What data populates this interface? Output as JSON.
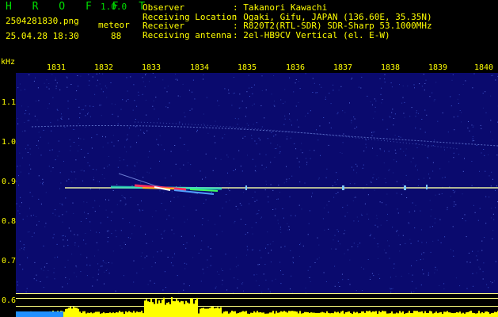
{
  "app": {
    "name": "H R O F F T",
    "version": "1.0.0"
  },
  "file": {
    "name": "2504281830.png",
    "datetime": "25.04.28 18:30"
  },
  "meteor": {
    "label": "meteor",
    "count": "88"
  },
  "info": [
    {
      "key": "Observer",
      "value": ": Takanori Kawachi"
    },
    {
      "key": "Receiving Location",
      "value": ": Ogaki, Gifu, JAPAN (136.60E, 35.35N)"
    },
    {
      "key": "Receiver",
      "value": ": R820T2(RTL-SDR) SDR-Sharp 53.1000MHz"
    },
    {
      "key": "Receiving antenna",
      "value": ": 2el-HB9CV Vertical (el. E-W)"
    }
  ],
  "axis": {
    "unit": "kHz",
    "y_ticks": [
      "1.1",
      "1.0",
      "0.9",
      "0.8",
      "0.7",
      "0.6"
    ],
    "x_ticks": [
      "1831",
      "1832",
      "1833",
      "1834",
      "1835",
      "1836",
      "1837",
      "1838",
      "1839",
      "1840"
    ]
  },
  "colors": {
    "background": "#000000",
    "spectrogram_bg": "#0a0a6e",
    "label": "#ffff00",
    "logo": "#00e000",
    "carrier": "#e8f0a0",
    "grid": "#ffff80"
  }
}
